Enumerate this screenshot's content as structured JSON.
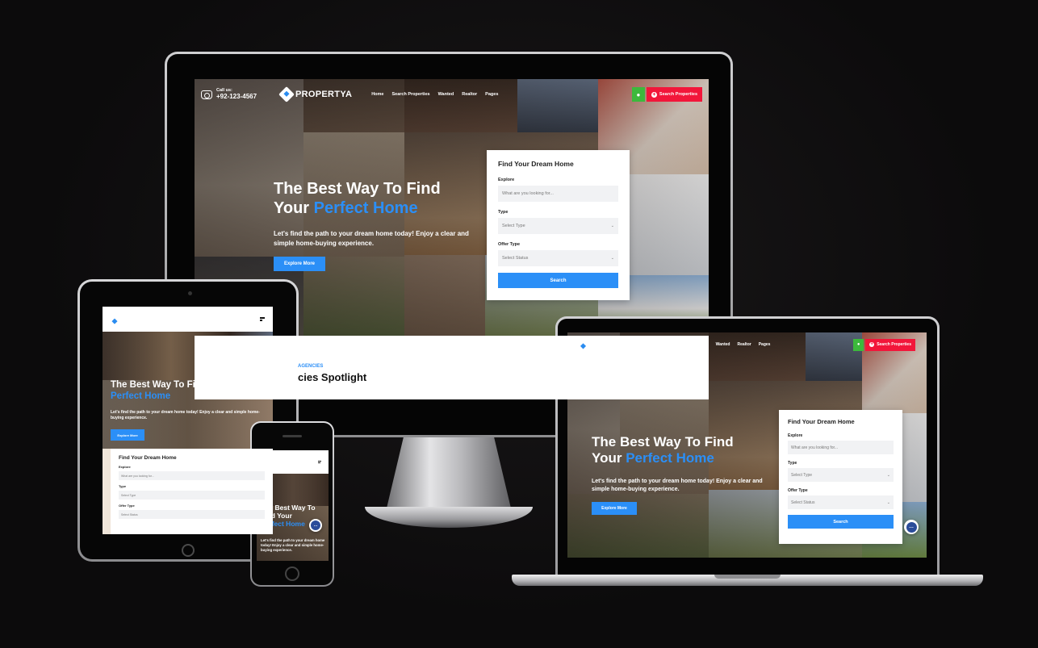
{
  "brand": {
    "name": "PROPERTYA",
    "accent": "#2b8ff7",
    "red": "#f2163a",
    "green": "#3cb93c"
  },
  "header": {
    "call_label": "Call us:",
    "call_number": "+92-123-4567",
    "nav": [
      "Home",
      "Search Properties",
      "Wanted",
      "Realtor",
      "Pages"
    ],
    "search_button": "Search Properties",
    "user_icon": "user-icon",
    "menu_icon": "hamburger-icon"
  },
  "hero": {
    "title_line1": "The Best Way To Find",
    "title_your": "Your",
    "title_highlight": "Perfect Home",
    "subtitle": "Let's find the path to your dream home today! Enjoy a clear and simple home-buying experience.",
    "cta": "Explore More"
  },
  "tablet_hero": {
    "title_line1": "The Best Way To Find Your",
    "title_highlight": "Perfect Home",
    "subtitle": "Let's find the path to your dream home today! Enjoy a clear and simple home-buying experience.",
    "cta": "Explore More"
  },
  "phone_hero": {
    "title_line1": "The Best Way To",
    "title_line2": "Find Your",
    "title_highlight": "Perfect Home",
    "subtitle": "Let's find the path to your dream home today! Enjoy a clear and simple home-buying experience."
  },
  "finder": {
    "title": "Find Your Dream Home",
    "explore_label": "Explore",
    "explore_placeholder": "What are you looking for...",
    "type_label": "Type",
    "type_placeholder": "Select Type",
    "offer_label": "Offer Type",
    "offer_placeholder": "Select Status",
    "button": "Search"
  },
  "section_peek": {
    "eyebrow": "AGENCIES",
    "title": "cies Spotlight"
  }
}
